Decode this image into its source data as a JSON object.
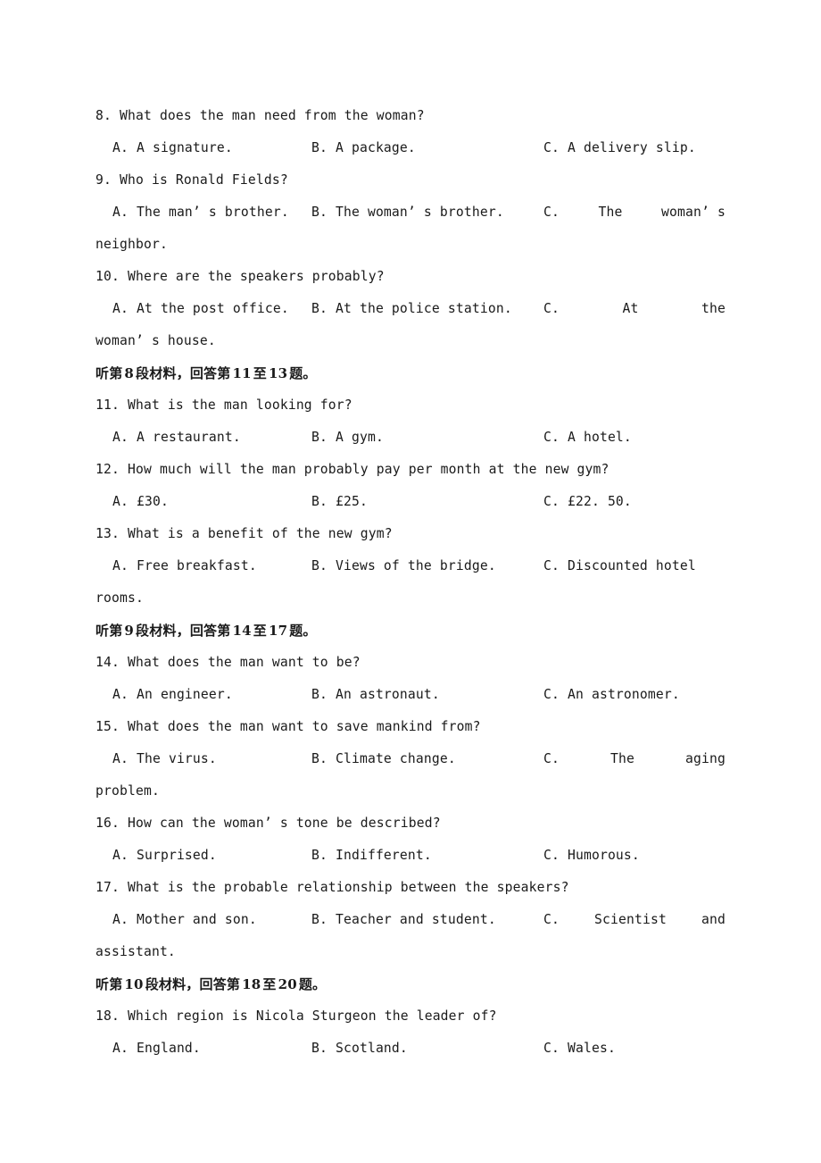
{
  "document": {
    "type": "english-listening-comprehension-exam",
    "text_color": "#1a1a1a",
    "background_color": "#ffffff"
  },
  "blocks": [
    {
      "kind": "question",
      "stem": "8. What does the man need from the woman?",
      "options": {
        "a": "A. A signature.",
        "b": "B. A package.",
        "c": "C. A delivery slip."
      }
    },
    {
      "kind": "question",
      "stem": "9. Who is Ronald Fields?",
      "options": {
        "a": "A. The man’ s brother.",
        "b": "B. The woman’ s brother.",
        "c_parts": [
          "C.",
          "The",
          "woman’ s"
        ],
        "c_wrap": "neighbor."
      }
    },
    {
      "kind": "question",
      "stem": "10. Where are the speakers probably?",
      "options": {
        "a": "A. At the post office.",
        "b": "B. At the police station.",
        "c_parts": [
          "C.",
          "At",
          "the"
        ],
        "c_wrap": "woman’ s house."
      }
    },
    {
      "kind": "heading",
      "pre": "听第",
      "num1": "8",
      "mid": "段材料，回答第",
      "num2": "11",
      "zhi": "至",
      "num3": "13",
      "post": "题。"
    },
    {
      "kind": "question",
      "stem": "11. What is the man looking for?",
      "options": {
        "a": "A. A restaurant.",
        "b": "B. A gym.",
        "c": "C. A hotel."
      }
    },
    {
      "kind": "question",
      "stem": "12. How much will the man probably pay per month at the new gym?",
      "options": {
        "a": "A. £30.",
        "b": "B. £25.",
        "c": "C. £22. 50."
      }
    },
    {
      "kind": "question",
      "stem": "13. What is a benefit of the new gym?",
      "options": {
        "a": "A. Free breakfast.",
        "b": "B. Views of the bridge.",
        "c": "C. Discounted hotel",
        "c_wrap": "rooms."
      }
    },
    {
      "kind": "heading",
      "pre": "听第",
      "num1": "9",
      "mid": "段材料，回答第",
      "num2": "14",
      "zhi": "至",
      "num3": "17",
      "post": "题。"
    },
    {
      "kind": "question",
      "stem": "14. What does the man want to be?",
      "options": {
        "a": "A. An engineer.",
        "b": "B. An astronaut.",
        "c": "C. An astronomer."
      }
    },
    {
      "kind": "question",
      "stem": "15. What does the man want to save mankind from?",
      "options": {
        "a": "A. The virus.",
        "b": "B. Climate change.",
        "c_parts": [
          "C.",
          "The",
          "aging"
        ],
        "c_wrap": "problem."
      }
    },
    {
      "kind": "question",
      "stem": "16. How can the woman’ s tone be described?",
      "options": {
        "a": "A. Surprised.",
        "b": "B. Indifferent.",
        "c": "C. Humorous."
      }
    },
    {
      "kind": "question",
      "stem": "17. What is the probable relationship between the speakers?",
      "options": {
        "a": "A. Mother and son.",
        "b": "B. Teacher and student.",
        "c_parts": [
          "C.",
          "Scientist",
          "and"
        ],
        "c_wrap": "assistant."
      }
    },
    {
      "kind": "heading",
      "pre": "听第",
      "num1": "10",
      "mid": "段材料，回答第",
      "num2": "18",
      "zhi": "至",
      "num3": "20",
      "post": "题。"
    },
    {
      "kind": "question",
      "stem": "18. Which region is Nicola Sturgeon the leader of?",
      "options": {
        "a": "A. England.",
        "b": "B. Scotland.",
        "c": "C. Wales."
      }
    }
  ]
}
